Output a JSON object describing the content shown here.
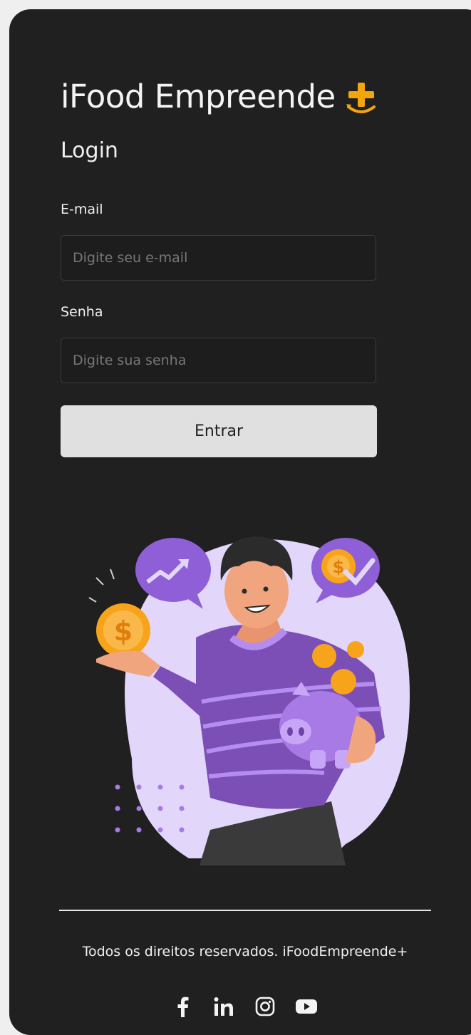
{
  "brand": {
    "name": "iFood Empreende",
    "mark": "plus-with-smile-icon",
    "accent_color": "#f2a50c"
  },
  "login": {
    "title": "Login",
    "email_label": "E-mail",
    "email_placeholder": "Digite seu e-mail",
    "email_value": "",
    "password_label": "Senha",
    "password_placeholder": "Digite sua senha",
    "password_value": "",
    "submit_label": "Entrar"
  },
  "footer": {
    "copyright": "Todos os direitos reservados. iFoodEmpreende+",
    "socials": [
      "facebook-icon",
      "linkedin-icon",
      "instagram-icon",
      "youtube-icon"
    ]
  },
  "colors": {
    "background": "#202020",
    "button": "#e0e0e0",
    "purple": "#7b4fb5",
    "light_purple": "#e3d6fb"
  }
}
